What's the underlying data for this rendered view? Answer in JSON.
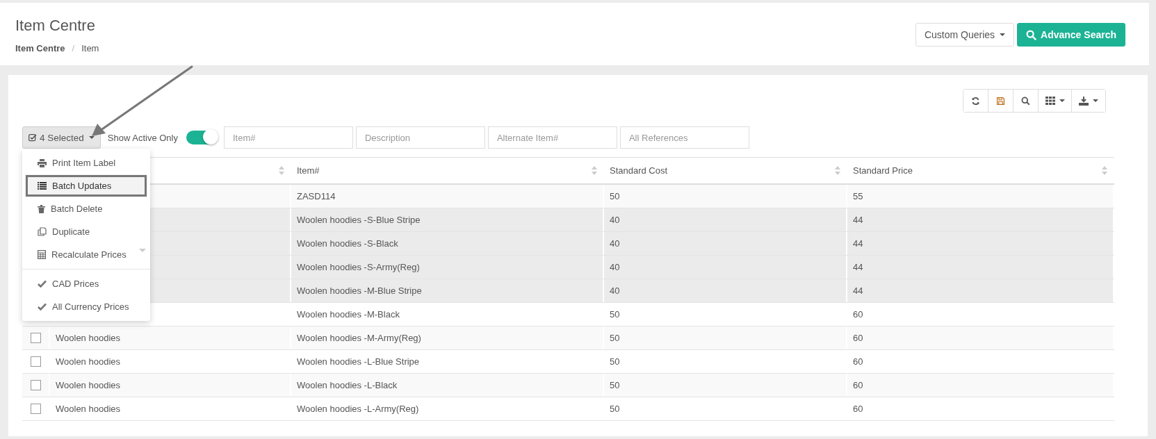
{
  "header": {
    "title": "Item Centre",
    "breadcrumb_separator": "/",
    "breadcrumb": [
      {
        "label": "Item Centre",
        "current": false
      },
      {
        "label": "Item",
        "current": true
      }
    ],
    "custom_queries": "Custom Queries",
    "advance_search": "Advance Search"
  },
  "toolbar": {
    "selected_button": "4 Selected",
    "show_active_label": "Show Active Only",
    "show_active_on": true,
    "filters": [
      {
        "placeholder": "Item#"
      },
      {
        "placeholder": "Description"
      },
      {
        "placeholder": "Alternate Item#"
      },
      {
        "placeholder": "All References"
      }
    ]
  },
  "menu": [
    {
      "kind": "action",
      "label": "Print Item Label",
      "highlighted": false
    },
    {
      "kind": "action",
      "label": "Batch Updates",
      "highlighted": true
    },
    {
      "kind": "action",
      "label": "Batch Delete",
      "highlighted": false
    },
    {
      "kind": "action",
      "label": "Duplicate",
      "highlighted": false
    },
    {
      "kind": "submenu",
      "label": "Recalculate Prices",
      "highlighted": false
    },
    {
      "kind": "check",
      "label": "CAD Prices",
      "highlighted": false
    },
    {
      "kind": "check",
      "label": "All Currency Prices",
      "highlighted": false
    }
  ],
  "table": {
    "columns": [
      "Item#",
      "Standard Cost",
      "Standard Price"
    ],
    "rows": [
      {
        "selected": false,
        "item": "ZASD114",
        "cost": "50",
        "price": "55"
      },
      {
        "selected": true,
        "item": "Woolen hoodies -S-Blue Stripe",
        "cost": "40",
        "price": "44"
      },
      {
        "selected": true,
        "item": "Woolen hoodies -S-Black",
        "cost": "40",
        "price": "44"
      },
      {
        "selected": true,
        "item": "Woolen hoodies -S-Army(Reg)",
        "cost": "40",
        "price": "44"
      },
      {
        "selected": true,
        "item": "Woolen hoodies -M-Blue Stripe",
        "cost": "40",
        "price": "44"
      },
      {
        "selected": false,
        "item": "Woolen hoodies -M-Black",
        "cost": "50",
        "price": "60"
      },
      {
        "selected": false,
        "description": "Woolen hoodies",
        "item": "Woolen hoodies -M-Army(Reg)",
        "cost": "50",
        "price": "60"
      },
      {
        "selected": false,
        "description": "Woolen hoodies",
        "item": "Woolen hoodies -L-Blue Stripe",
        "cost": "50",
        "price": "60"
      },
      {
        "selected": false,
        "description": "Woolen hoodies",
        "item": "Woolen hoodies -L-Black",
        "cost": "50",
        "price": "60"
      },
      {
        "selected": false,
        "description": "Woolen hoodies",
        "item": "Woolen hoodies -L-Army(Reg)",
        "cost": "50",
        "price": "60"
      }
    ]
  }
}
